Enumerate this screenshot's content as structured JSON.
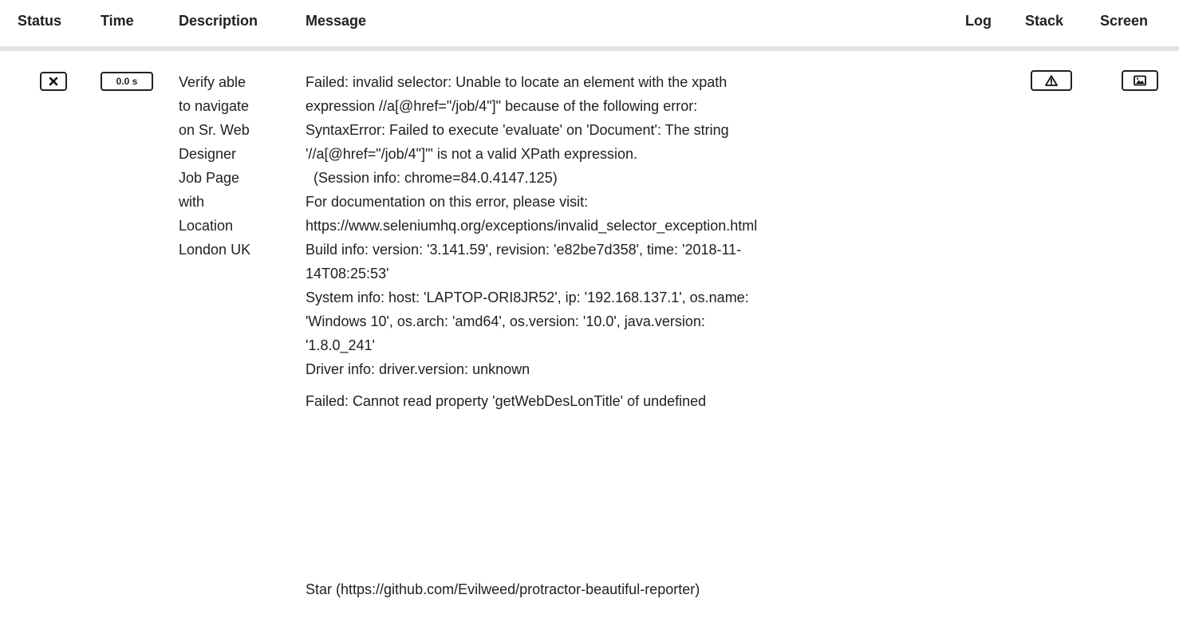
{
  "table": {
    "headers": {
      "status": "Status",
      "time": "Time",
      "description": "Description",
      "message": "Message",
      "log": "Log",
      "stack": "Stack",
      "screen": "Screen"
    },
    "row": {
      "status_icon": "close-icon",
      "time": "0.0 s",
      "description_lines": [
        "Verify able",
        "to navigate",
        "on Sr. Web",
        "Designer",
        "Job Page",
        "with",
        "Location",
        "London UK"
      ],
      "message_lines": [
        "Failed: invalid selector: Unable to locate an element with the xpath",
        "expression //a[@href=\"/job/4\"]\" because of the following error:",
        "SyntaxError: Failed to execute 'evaluate' on 'Document': The string",
        "'//a[@href=\"/job/4\"]\"' is not a valid XPath expression.",
        "  (Session info: chrome=84.0.4147.125)",
        "For documentation on this error, please visit:",
        "https://www.seleniumhq.org/exceptions/invalid_selector_exception.html",
        "Build info: version: '3.141.59', revision: 'e82be7d358', time: '2018-11-",
        "14T08:25:53'",
        "System info: host: 'LAPTOP-ORI8JR52', ip: '192.168.137.1', os.name:",
        "'Windows 10', os.arch: 'amd64', os.version: '10.0', java.version:",
        "'1.8.0_241'",
        "Driver info: driver.version: unknown"
      ],
      "message_second": "Failed: Cannot read property 'getWebDesLonTitle' of undefined",
      "stack_icon": "warning-icon",
      "screen_icon": "image-icon"
    }
  },
  "footer": {
    "star_link": "Star (https://github.com/Evilweed/protractor-beautiful-reporter)"
  }
}
